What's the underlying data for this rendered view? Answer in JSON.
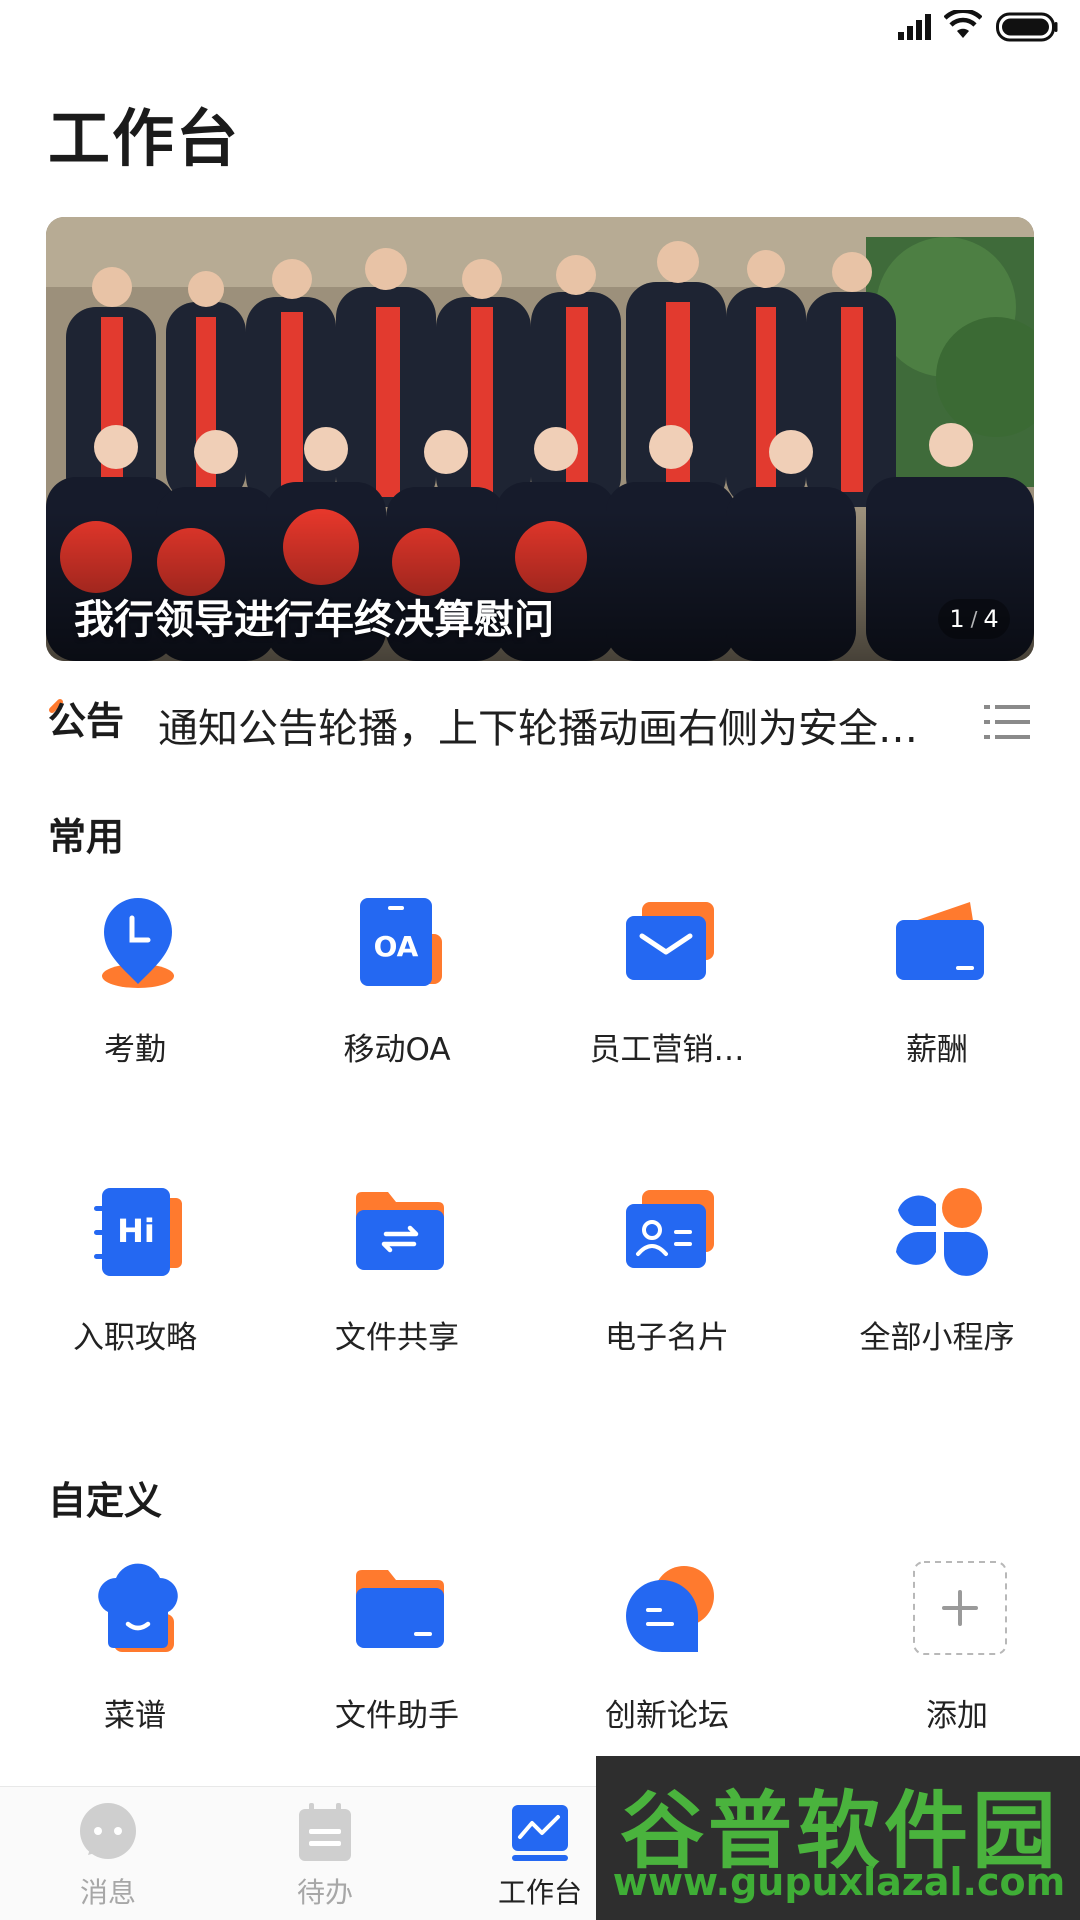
{
  "page": {
    "title": "工作台"
  },
  "banner": {
    "caption": "我行领导进行年终决算慰问",
    "pager_current": "1",
    "pager_total": "4"
  },
  "notice": {
    "badge": "公告",
    "text": "通知公告轮播，上下轮播动画右侧为安全…"
  },
  "sections": {
    "common": {
      "title": "常用",
      "items": [
        {
          "label": "考勤",
          "icon": "attendance-icon"
        },
        {
          "label": "移动OA",
          "icon": "oa-icon"
        },
        {
          "label": "员工营销…",
          "icon": "mail-icon"
        },
        {
          "label": "薪酬",
          "icon": "salary-card-icon"
        },
        {
          "label": "入职攻略",
          "icon": "onboarding-hi-icon"
        },
        {
          "label": "文件共享",
          "icon": "folder-share-icon"
        },
        {
          "label": "电子名片",
          "icon": "business-card-icon"
        },
        {
          "label": "全部小程序",
          "icon": "apps-grid-icon"
        }
      ]
    },
    "custom": {
      "title": "自定义",
      "items": [
        {
          "label": "菜谱",
          "icon": "chef-hat-icon"
        },
        {
          "label": "文件助手",
          "icon": "folder-icon"
        },
        {
          "label": "创新论坛",
          "icon": "chat-bubble-icon"
        },
        {
          "label": "添加",
          "icon": "add-icon"
        }
      ]
    }
  },
  "bottom_nav": [
    {
      "label": "消息",
      "icon": "message-icon",
      "active": false
    },
    {
      "label": "待办",
      "icon": "todo-icon",
      "active": false
    },
    {
      "label": "工作台",
      "icon": "workbench-icon",
      "active": true
    }
  ],
  "watermark": {
    "title": "谷普软件园",
    "url": "www.gupuxlazal.com"
  },
  "colors": {
    "primary_blue": "#2468f2",
    "accent_orange": "#ff7a2e",
    "text_dark": "#1b1b1b",
    "nav_inactive": "#a7a7a7"
  }
}
